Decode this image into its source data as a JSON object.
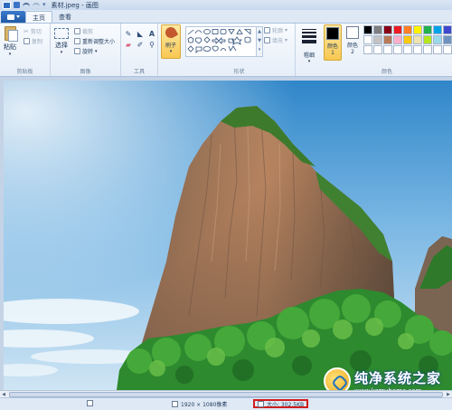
{
  "window": {
    "title": "素材.jpeg - 画图"
  },
  "tabs": [
    {
      "label": "主页",
      "active": true
    },
    {
      "label": "查看",
      "active": false
    }
  ],
  "ribbon": {
    "clipboard": {
      "paste": "粘贴",
      "cut": "剪切",
      "copy": "复制",
      "group": "剪贴板"
    },
    "image": {
      "select": "选择",
      "crop": "裁剪",
      "resize": "重新调整大小",
      "rotate": "旋转",
      "group": "图像"
    },
    "tools": {
      "group": "工具",
      "icons": [
        "pencil-icon",
        "fill-icon",
        "text-icon",
        "eraser-icon",
        "color-picker-icon",
        "magnifier-icon"
      ]
    },
    "brushes": {
      "label": "刷子"
    },
    "shapes": {
      "outline": "轮廓",
      "fill": "填充",
      "group": "形状"
    },
    "linesize": {
      "label": "粗细"
    },
    "colors": {
      "color1": {
        "label": "颜色 1",
        "value": "#000000"
      },
      "color2": {
        "label": "颜色 2",
        "value": "#ffffff"
      },
      "group": "颜色",
      "palette": [
        "#000000",
        "#7f7f7f",
        "#880015",
        "#ed1c24",
        "#ff7f27",
        "#fff200",
        "#22b14c",
        "#00a2e8",
        "#3f48cc",
        "#ffffff",
        "#c3c3c3",
        "#b97a57",
        "#ffaec9",
        "#ffc90e",
        "#efe4b0",
        "#b5e61d",
        "#99d9ea",
        "#7092be",
        "#ffffff",
        "#ffffff",
        "#ffffff",
        "#ffffff",
        "#ffffff",
        "#ffffff",
        "#ffffff",
        "#ffffff",
        "#ffffff"
      ]
    }
  },
  "status": {
    "dimensions": "1920 × 1080像素",
    "size": "大小: 302.5KB"
  },
  "watermark": {
    "title": "纯净系统之家",
    "url": "www.kzmyhome.com"
  }
}
